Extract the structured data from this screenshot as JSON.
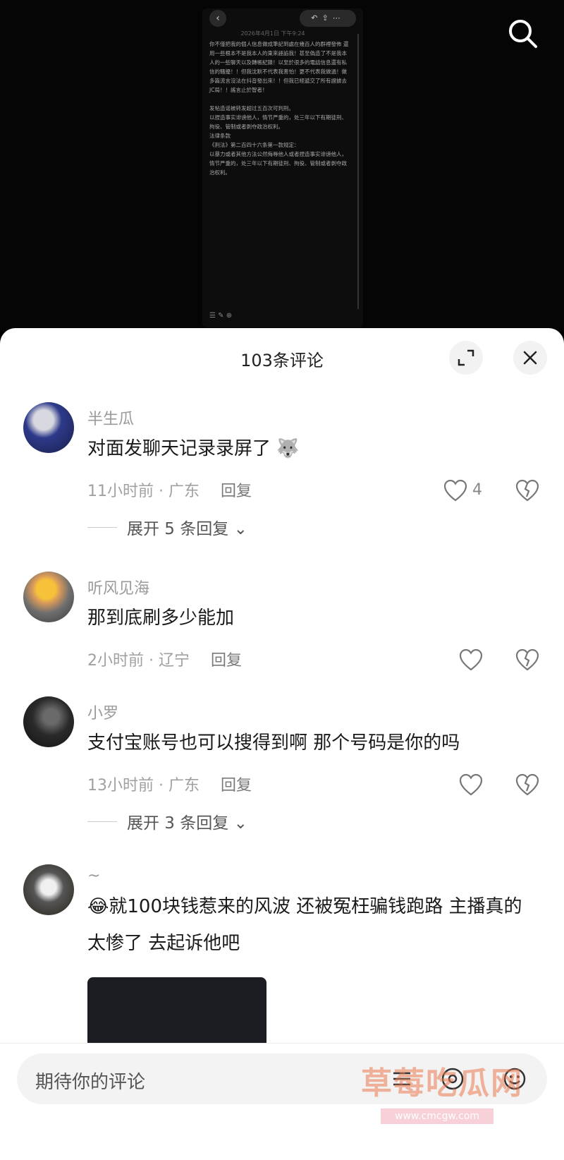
{
  "video_note": {
    "date": "2026年4月1日 下午9:24",
    "body": "你不僅把我的個人信息做成筆記到處在幾百人的群裡發佈 還用一些根本不是我本人的東來誣諂我！甚至偽造了不是我本人的一些聊天以及轉帳紀錄！以至於很多的電話信息還有私信的騷擾！！但我沈默不代表我害怕！更不代表我做過！做多篇流言沒法在抖音發出來！！但我已經遞交了所有證據去JC局！！謠言止於智者！\n\n发帖造谣被转发超过五百次可判刑。\n以捏造事实诽谤他人，情节严重的，处三年以下有期徒刑、拘役、管制或者剥夺政治权利。\n法律条款\n《刑法》第二百四十六条第一款规定：\n以暴力或者其他方法公然侮辱他人或者捏造事实诽谤他人，情节严重的，处三年以下有期徒刑、拘役、管制或者剥夺政治权利。"
  },
  "sheet": {
    "title": "103条评论"
  },
  "comments": [
    {
      "name": "半生瓜",
      "text": "对面发聊天记录录屏了",
      "time_location": "11小时前 · 广东",
      "reply_label": "回复",
      "likes": "4",
      "expand": "展开 5 条回复"
    },
    {
      "name": "听风见海",
      "text": "那到底刷多少能加",
      "time_location": "2小时前 · 辽宁",
      "reply_label": "回复",
      "likes": ""
    },
    {
      "name": "小罗",
      "text": "支付宝账号也可以搜得到啊  那个号码是你的吗",
      "time_location": "13小时前 · 广东",
      "reply_label": "回复",
      "likes": "",
      "expand": "展开 3 条回复"
    },
    {
      "name": "~",
      "text": "就100块钱惹来的风波 还被冤枉骗钱跑路 主播真的太惨了 去起诉他吧",
      "emoji": "😂"
    }
  ],
  "input": {
    "placeholder": "期待你的评论"
  },
  "watermark": {
    "text": "草莓吃瓜网",
    "url": "www.cmcgw.com"
  },
  "colors": {
    "sheet_bg": "#ffffff",
    "meta_text": "#a0a0a0",
    "watermark": "#eb7850"
  }
}
